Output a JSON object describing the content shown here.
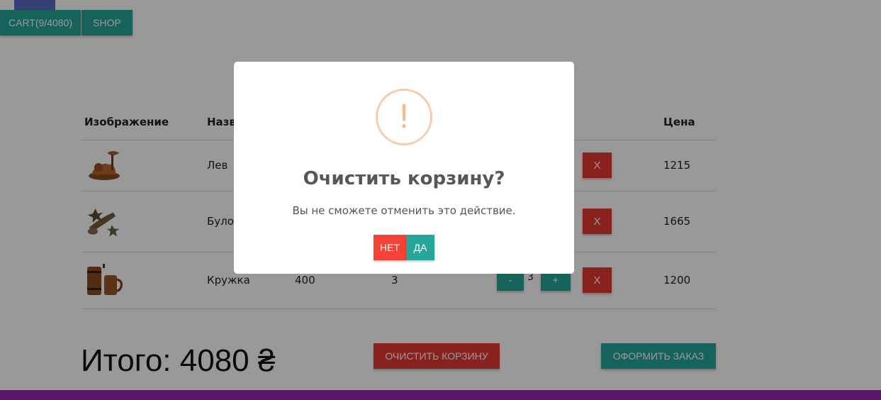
{
  "nav": {
    "cart_label": "CART(9/4080)",
    "shop_label": "SHOP"
  },
  "table": {
    "headers": [
      "Изображение",
      "Название",
      "",
      "",
      "",
      "",
      "Цена"
    ],
    "rows": [
      {
        "image_icon": "lion-figurine-image",
        "name": "Лев",
        "price": "",
        "qty": "",
        "delete_label": "X",
        "sum": "1215"
      },
      {
        "image_icon": "mace-souvenir-image",
        "name": "Булова",
        "price": "",
        "qty": "",
        "delete_label": "X",
        "sum": "1665"
      },
      {
        "image_icon": "beer-mug-image",
        "name": "Кружка",
        "price": "400",
        "qty": "3",
        "minus_label": "-",
        "qty_value": "3",
        "plus_label": "+",
        "delete_label": "X",
        "sum": "1200"
      }
    ]
  },
  "summary": {
    "total": "Итого: 4080 ₴",
    "clear_label": "ОЧИСТИТЬ КОРЗИНУ",
    "order_label": "ОФОРМИТЬ ЗАКАЗ"
  },
  "dialog": {
    "icon": "warning-icon",
    "icon_glyph": "!",
    "title": "Очистить корзину?",
    "text": "Вы не сможете отменить это действие.",
    "no_label": "НЕТ",
    "yes_label": "ДА"
  },
  "colors": {
    "teal": "#26a69a",
    "red": "#e53935",
    "purple": "#9c27b0",
    "warning": "#f8bb86"
  }
}
